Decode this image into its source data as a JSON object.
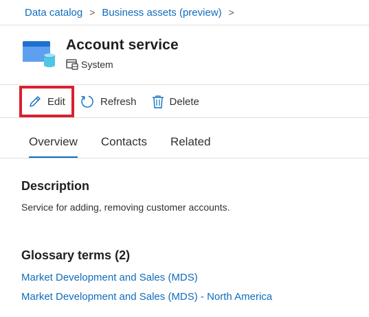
{
  "breadcrumb": {
    "items": [
      "Data catalog",
      "Business assets (preview)"
    ],
    "separator": ">"
  },
  "asset": {
    "title": "Account service",
    "type_label": "System",
    "icon": "database-table-icon"
  },
  "commands": {
    "edit": "Edit",
    "refresh": "Refresh",
    "delete": "Delete"
  },
  "tabs": [
    {
      "label": "Overview",
      "active": true
    },
    {
      "label": "Contacts",
      "active": false
    },
    {
      "label": "Related",
      "active": false
    }
  ],
  "description": {
    "heading": "Description",
    "text": "Service for adding, removing customer accounts."
  },
  "glossary": {
    "heading": "Glossary terms (2)",
    "terms": [
      "Market Development and Sales (MDS)",
      "Market Development and Sales (MDS) - North America"
    ]
  },
  "colors": {
    "link": "#0f6cbd",
    "highlight_border": "#d92030",
    "divider": "#e1dfdd"
  }
}
